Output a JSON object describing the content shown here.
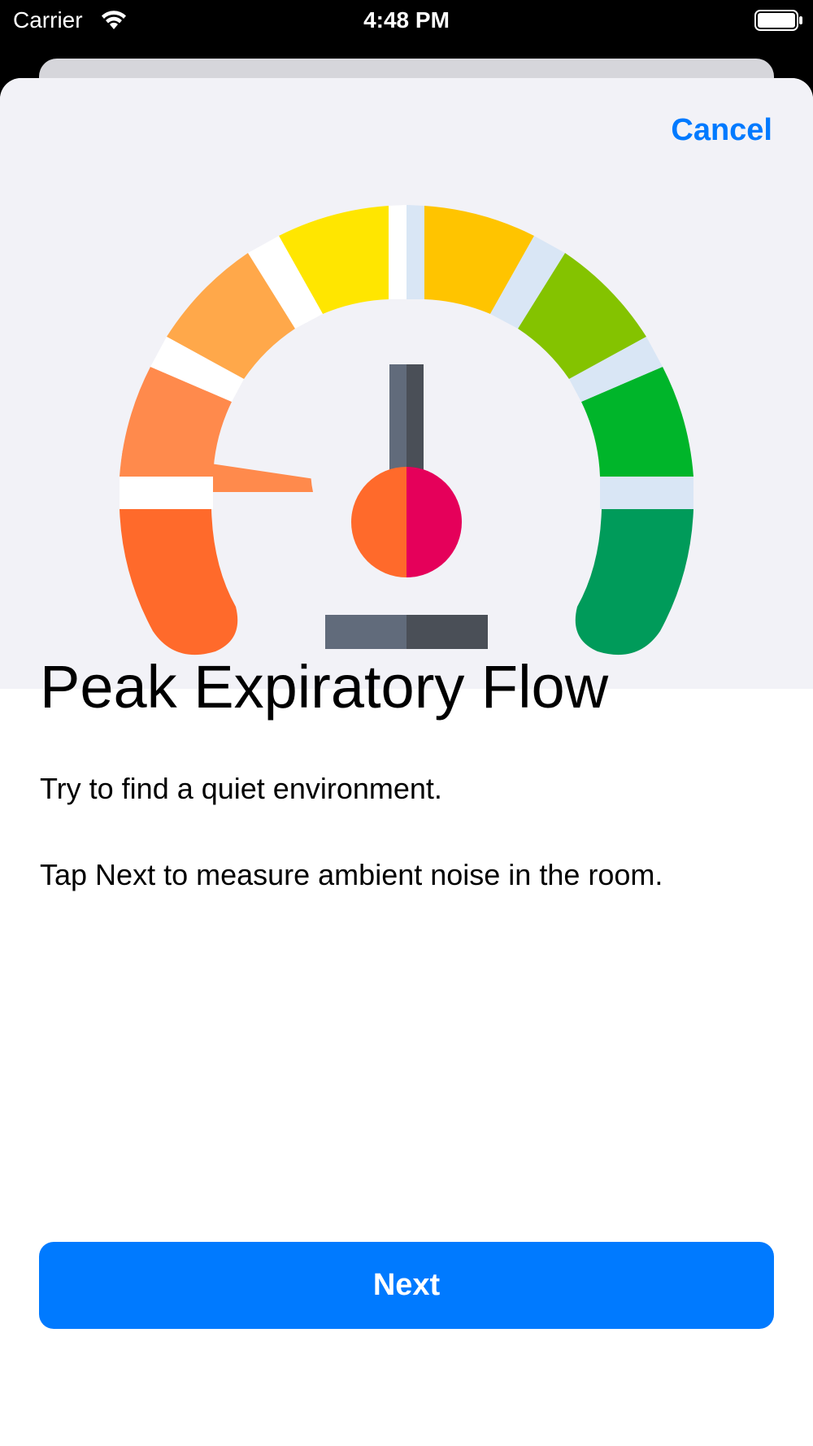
{
  "status_bar": {
    "carrier": "Carrier",
    "time": "4:48 PM",
    "icons": [
      "wifi-icon",
      "battery-icon"
    ]
  },
  "sheet": {
    "cancel_label": "Cancel",
    "illustration": "peak-flow-gauge-icon",
    "title": "Peak Expiratory Flow",
    "instructions": [
      "Try to find a quiet environment.",
      "Tap Next to measure ambient noise in the room."
    ],
    "next_label": "Next"
  },
  "colors": {
    "accent": "#007aff",
    "hero_background": "#f2f2f7",
    "gauge_segments": [
      "#ff6a2b",
      "#ff8a4c",
      "#ffa84a",
      "#ffe600",
      "#ffc400",
      "#84c300",
      "#00b52a",
      "#009b5a"
    ],
    "needle_left": "#ff6a2b",
    "needle_right": "#e5005a"
  }
}
